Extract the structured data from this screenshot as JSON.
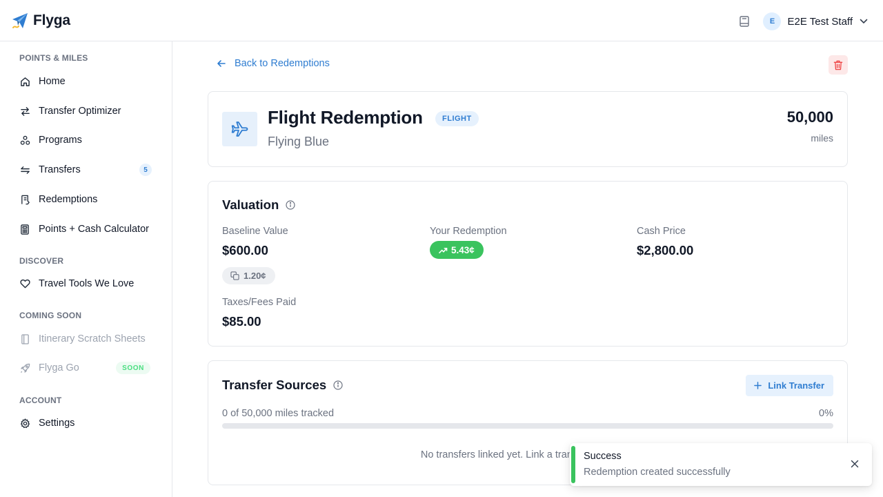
{
  "app": {
    "brand_name": "Flyga"
  },
  "header": {
    "user_initial": "E",
    "user_name": "E2E Test Staff"
  },
  "sidebar": {
    "sections": {
      "points_miles": "POINTS & MILES",
      "discover": "DISCOVER",
      "coming_soon": "COMING SOON",
      "account": "ACCOUNT"
    },
    "items": {
      "home": "Home",
      "transfer_optimizer": "Transfer Optimizer",
      "programs": "Programs",
      "transfers": "Transfers",
      "transfers_count": "5",
      "redemptions": "Redemptions",
      "points_cash_calculator": "Points + Cash Calculator",
      "travel_tools": "Travel Tools We Love",
      "itinerary": "Itinerary Scratch Sheets",
      "flyga_go": "Flyga Go",
      "flyga_go_badge": "SOON",
      "settings": "Settings"
    }
  },
  "main": {
    "back_label": "Back to Redemptions",
    "redemption": {
      "title": "Flight Redemption",
      "type_badge": "FLIGHT",
      "program": "Flying Blue",
      "miles": "50,000",
      "miles_unit": "miles"
    },
    "valuation": {
      "title": "Valuation",
      "baseline_label": "Baseline Value",
      "baseline_value": "$600.00",
      "baseline_cpp": "1.20¢",
      "your_label": "Your Redemption",
      "your_cpp": "5.43¢",
      "cash_label": "Cash Price",
      "cash_value": "$2,800.00",
      "taxes_label": "Taxes/Fees Paid",
      "taxes_value": "$85.00"
    },
    "transfers": {
      "title": "Transfer Sources",
      "link_button": "Link Transfer",
      "tracked": "0 of 50,000 miles tracked",
      "percent": "0%",
      "progress_fraction": 0,
      "empty_message": "No transfers linked yet. Link a transfer to track w"
    }
  },
  "toast": {
    "title": "Success",
    "message": "Redemption created successfully"
  },
  "colors": {
    "accent": "#2f7dd1",
    "success": "#3ac35e",
    "danger": "#ef4444",
    "muted_text": "#6b7280"
  }
}
